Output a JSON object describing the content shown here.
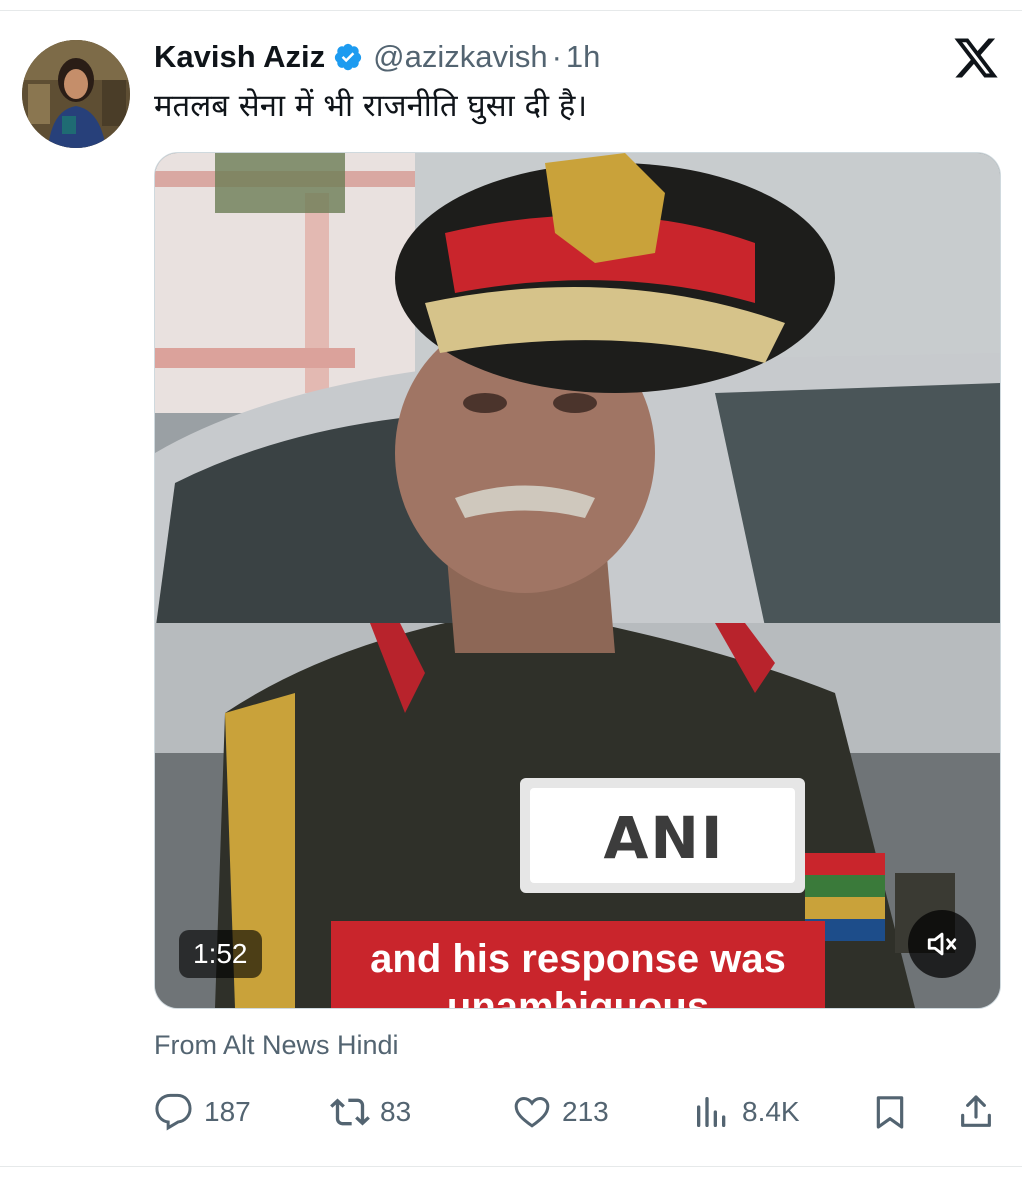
{
  "tweet": {
    "author_name": "Kavish Aziz",
    "handle": "@azizkavish",
    "separator": "·",
    "time": "1h",
    "text": "मतलब सेना में भी राजनीति घुसा दी है।",
    "source": "From Alt News Hindi"
  },
  "media": {
    "duration": "1:52",
    "caption_line1": "and his response was",
    "caption_line2": "unambiguous",
    "mic_brand": "ANI"
  },
  "actions": {
    "replies": "187",
    "reposts": "83",
    "likes": "213",
    "views": "8.4K"
  },
  "colors": {
    "verified_blue": "#1d9bf0",
    "secondary_text": "#536471",
    "caption_red": "#c9252c"
  },
  "icons": {
    "platform": "x-logo-icon",
    "verified": "verified-badge-icon",
    "mute": "speaker-muted-icon",
    "reply": "reply-bubble-icon",
    "repost": "repost-arrows-icon",
    "like": "heart-icon",
    "views": "bar-chart-icon",
    "bookmark": "bookmark-icon",
    "share": "share-upload-icon"
  }
}
